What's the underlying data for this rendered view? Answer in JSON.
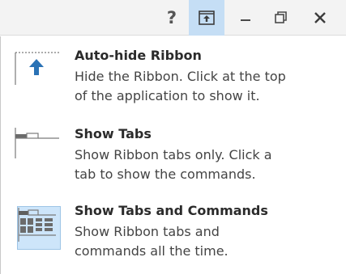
{
  "caption_buttons": {
    "help_label": "?",
    "ribbon_display_options": "ribbon-display-options-icon",
    "minimize": "minimize-icon",
    "restore": "restore-icon",
    "close": "close-icon"
  },
  "menu": {
    "items": [
      {
        "title": "Auto-hide Ribbon",
        "description_line1": "Hide the Ribbon. Click at the top",
        "description_line2": "of the application to show it.",
        "icon": "auto-hide-ribbon-icon",
        "selected": false
      },
      {
        "title": "Show Tabs",
        "description_line1": "Show Ribbon tabs only. Click a",
        "description_line2": "tab to show the commands.",
        "icon": "show-tabs-icon",
        "selected": false
      },
      {
        "title": "Show Tabs and Commands",
        "description_line1": "Show Ribbon tabs and",
        "description_line2": "commands all the time.",
        "icon": "show-tabs-and-commands-icon",
        "selected": true
      }
    ]
  },
  "colors": {
    "active_button_bg": "#c5def5",
    "selected_item_bg": "#cde5fa",
    "arrow_blue": "#2a72b5"
  }
}
